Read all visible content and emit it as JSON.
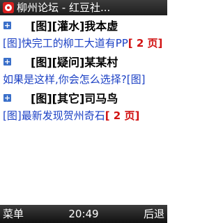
{
  "app": {
    "title": "柳州论坛 - 红豆社..."
  },
  "posts": [
    {
      "thread_title": "[图][灌水]我本虚",
      "link": "[图]快完工的柳工大道有PP",
      "pages": "[ 2 页]"
    },
    {
      "thread_title": "[图][疑问]某某村",
      "link": "如果是这样,你会怎么选择?[图]",
      "pages": ""
    },
    {
      "thread_title": "[图][其它]司马鸟",
      "link": "[图]最新发现贺州奇石",
      "pages": "[ 2 页]"
    }
  ],
  "softkeys": {
    "left": "菜单",
    "time": "20:49",
    "right": "后退"
  }
}
